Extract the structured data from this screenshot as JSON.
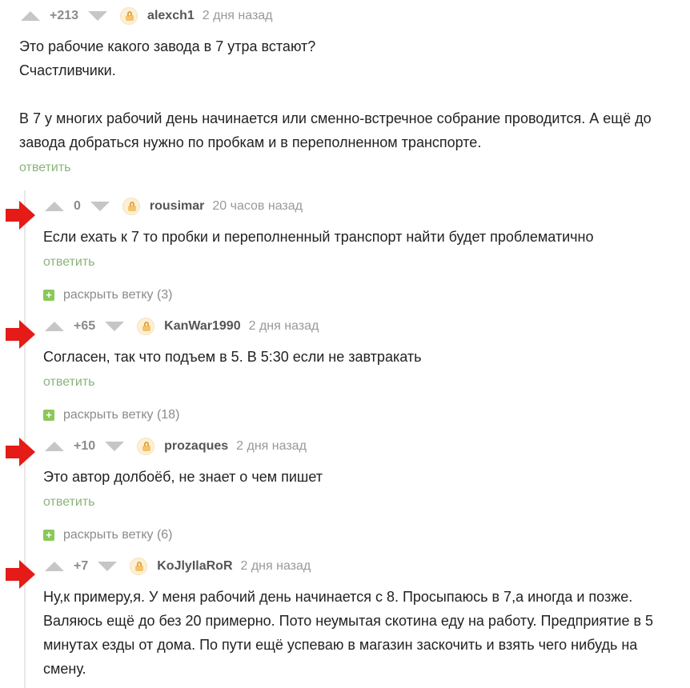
{
  "colors": {
    "arrow": "#e41b17",
    "reply": "#8ab47a",
    "plus": "#8ac858"
  },
  "icons": {
    "vote_up": "triangle-up-icon",
    "vote_down": "triangle-down-icon",
    "avatar": "lock-avatar-icon",
    "expand": "plus-icon",
    "marker": "red-arrow-icon"
  },
  "comments": [
    {
      "rating": "+213",
      "user": "alexch1",
      "time": "2 дня назад",
      "lines": [
        "Это рабочие какого завода в 7 утра встают?",
        "Счастливчики.",
        "",
        "В 7 у многих рабочий день начинается или сменно-встречное собрание проводится. А ещё до",
        "завода добраться нужно по пробкам и в переполненном транспорте."
      ],
      "reply": "ответить"
    },
    {
      "rating": "0",
      "user": "rousimar",
      "time": "20 часов назад",
      "lines": [
        "Если ехать к 7 то пробки и переполненный транспорт найти будет проблематично"
      ],
      "reply": "ответить",
      "expand": "раскрыть ветку (3)"
    },
    {
      "rating": "+65",
      "user": "KanWar1990",
      "time": "2 дня назад",
      "lines": [
        "Согласен, так что подъем в 5. В 5:30 если не завтракать"
      ],
      "reply": "ответить",
      "expand": "раскрыть ветку (18)"
    },
    {
      "rating": "+10",
      "user": "prozaques",
      "time": "2 дня назад",
      "lines": [
        "Это автор долбоёб, не знает о чем пишет"
      ],
      "reply": "ответить",
      "expand": "раскрыть ветку (6)"
    },
    {
      "rating": "+7",
      "user": "KoJlyIlaRoR",
      "time": "2 дня назад",
      "lines": [
        "Ну,к примеру,я. У меня рабочий день начинается с 8. Просыпаюсь в 7,а иногда и позже.",
        "Валяюсь ещё до без 20 примерно. Пото неумытая скотина еду на работу. Предприятие в 5",
        "минутах езды от дома. По пути ещё успеваю в магазин заскочить и взять чего нибудь на",
        "смену."
      ]
    }
  ]
}
